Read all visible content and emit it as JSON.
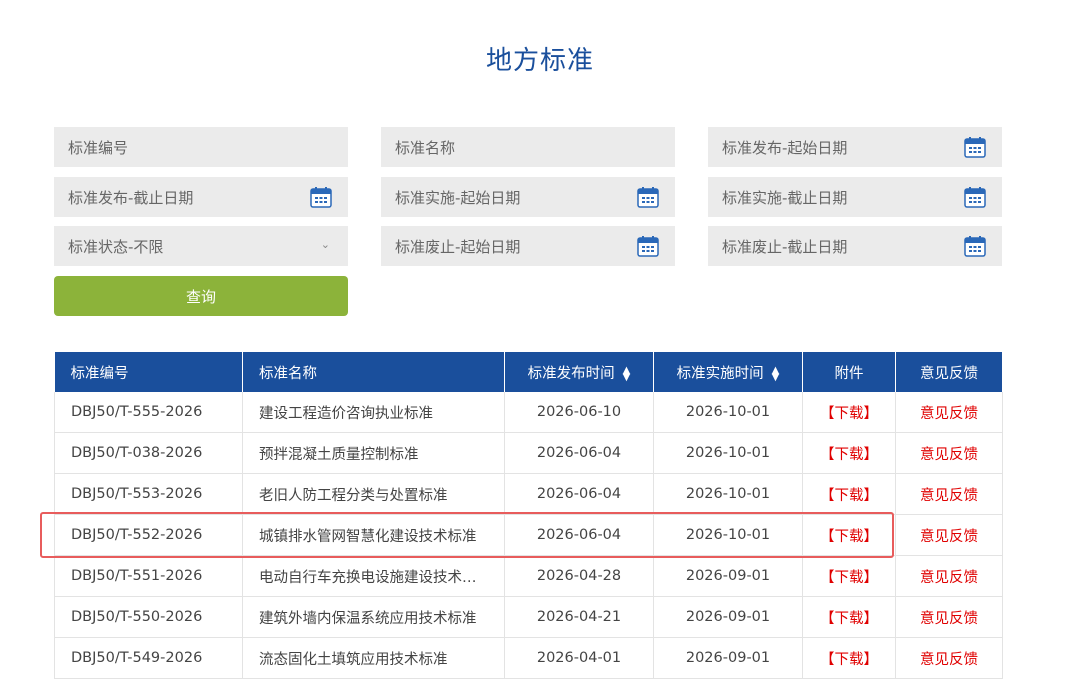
{
  "page": {
    "title": "地方标准"
  },
  "filters": {
    "std_no": "标准编号",
    "std_name": "标准名称",
    "publish_start": "标准发布-起始日期",
    "publish_end": "标准发布-截止日期",
    "impl_start": "标准实施-起始日期",
    "impl_end": "标准实施-截止日期",
    "status": "标准状态-不限",
    "abolish_start": "标准废止-起始日期",
    "abolish_end": "标准废止-截止日期",
    "query_label": "查询"
  },
  "table": {
    "headers": [
      "标准编号",
      "标准名称",
      "标准发布时间",
      "标准实施时间",
      "附件",
      "意见反馈"
    ],
    "rows": [
      {
        "no": "DBJ50/T-555-2026",
        "name": "建设工程造价咨询执业标准",
        "publish": "2026-06-10",
        "impl": "2026-10-01",
        "attach": "【下载】",
        "feedback": "意见反馈"
      },
      {
        "no": "DBJ50/T-038-2026",
        "name": "预拌混凝土质量控制标准",
        "publish": "2026-06-04",
        "impl": "2026-10-01",
        "attach": "【下载】",
        "feedback": "意见反馈"
      },
      {
        "no": "DBJ50/T-553-2026",
        "name": "老旧人防工程分类与处置标准",
        "publish": "2026-06-04",
        "impl": "2026-10-01",
        "attach": "【下载】",
        "feedback": "意见反馈"
      },
      {
        "no": "DBJ50/T-552-2026",
        "name": "城镇排水管网智慧化建设技术标准",
        "publish": "2026-06-04",
        "impl": "2026-10-01",
        "attach": "【下载】",
        "feedback": "意见反馈"
      },
      {
        "no": "DBJ50/T-551-2026",
        "name": "电动自行车充换电设施建设技术…",
        "publish": "2026-04-28",
        "impl": "2026-09-01",
        "attach": "【下载】",
        "feedback": "意见反馈"
      },
      {
        "no": "DBJ50/T-550-2026",
        "name": "建筑外墙内保温系统应用技术标准",
        "publish": "2026-04-21",
        "impl": "2026-09-01",
        "attach": "【下载】",
        "feedback": "意见反馈"
      },
      {
        "no": "DBJ50/T-549-2026",
        "name": "流态固化土填筑应用技术标准",
        "publish": "2026-04-01",
        "impl": "2026-09-01",
        "attach": "【下载】",
        "feedback": "意见反馈"
      }
    ]
  },
  "colors": {
    "header_bg": "#1a4f9c",
    "button_bg": "#8cb33a",
    "link_red": "#e00000",
    "highlight": "#e85c5c"
  }
}
